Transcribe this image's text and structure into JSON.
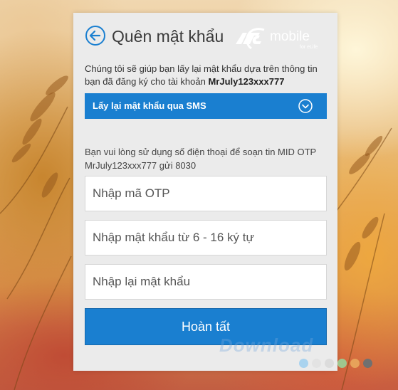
{
  "header": {
    "title": "Quên mật khẩu",
    "logo_text": "VTC mobile for eLife"
  },
  "intro": {
    "text": "Chúng tôi sẽ giúp bạn lấy lại mật khẩu dựa trên thông tin bạn đã đăng ký cho tài khoản ",
    "account": "MrJuly123xxx777"
  },
  "method": {
    "selected": "Lấy lại mật khẩu qua SMS"
  },
  "instruction": "Bạn vui lòng sử dụng số điện thoại để soạn tin MID OTP MrJuly123xxx777 gửi 8030",
  "fields": {
    "otp_placeholder": "Nhập mã OTP",
    "password_placeholder": "Nhập mật khẩu từ 6 - 16 ký tự",
    "confirm_placeholder": "Nhập lại mật khẩu"
  },
  "submit_label": "Hoàn tất",
  "watermark": "Download",
  "colors": {
    "accent": "#1a7fd0",
    "panel": "#ebebeb",
    "dots": [
      "#a9d3ef",
      "#e3e3e3",
      "#dcdcdc",
      "#9fc78e",
      "#e7a25a",
      "#707070"
    ]
  }
}
